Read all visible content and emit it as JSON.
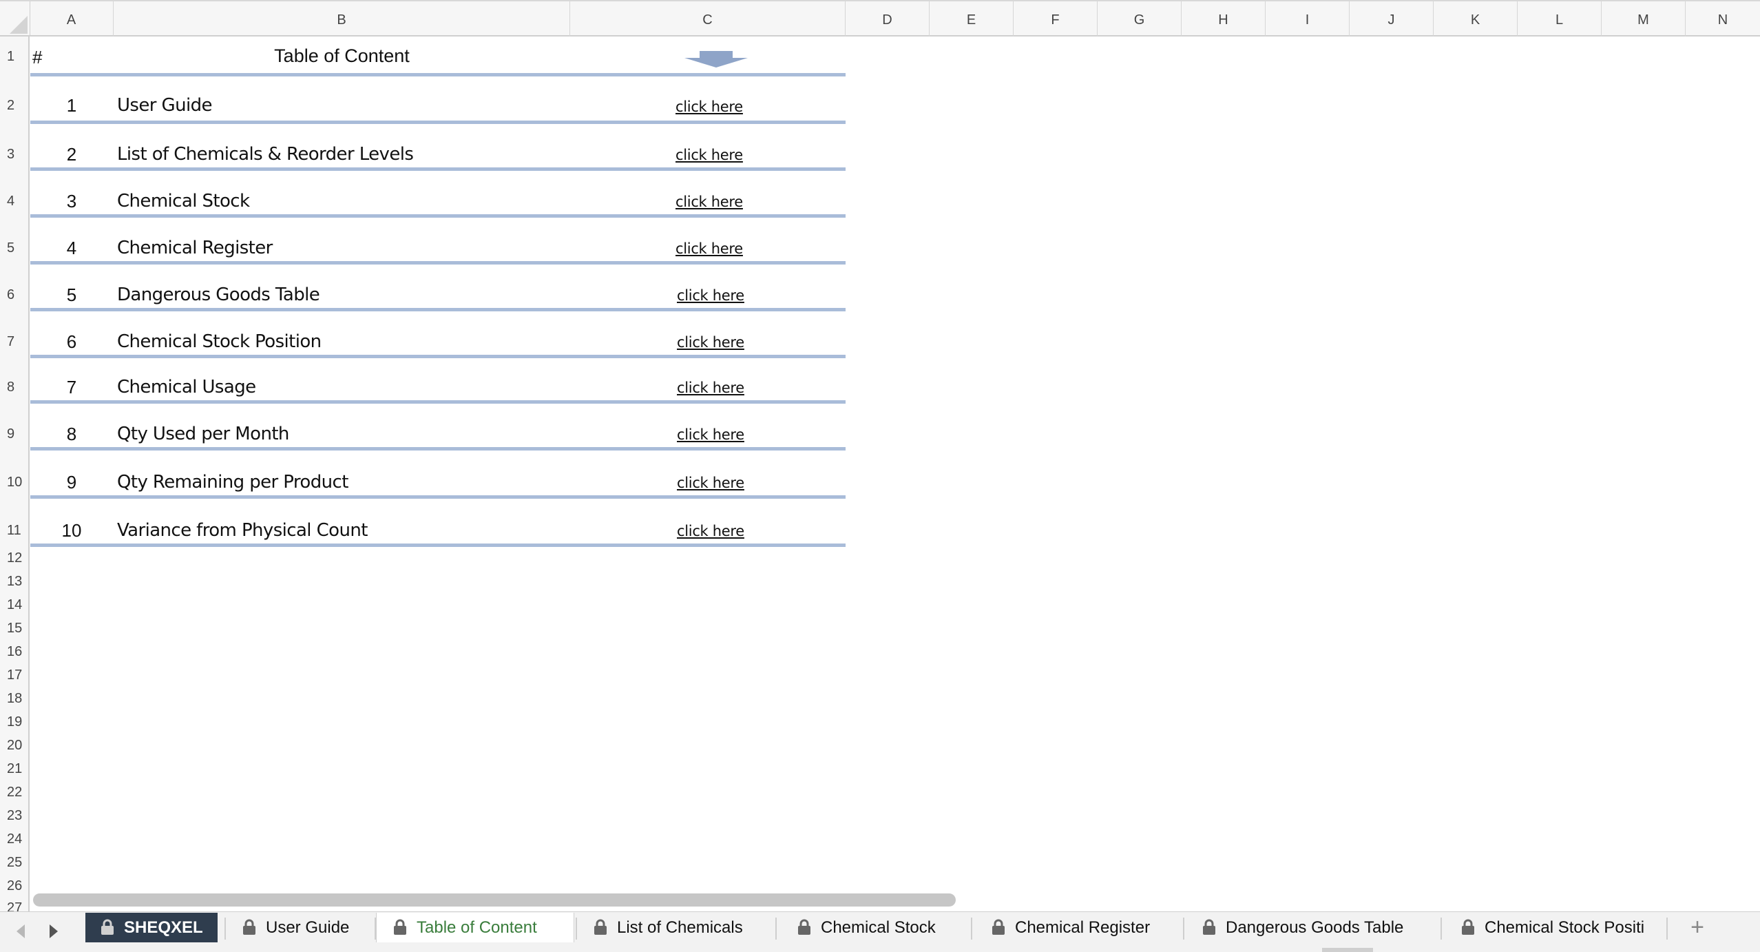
{
  "columns": [
    "A",
    "B",
    "C",
    "D",
    "E",
    "F",
    "G",
    "H",
    "I",
    "J",
    "K",
    "L",
    "M",
    "N"
  ],
  "rows": [
    "1",
    "2",
    "3",
    "4",
    "5",
    "6",
    "7",
    "8",
    "9",
    "10",
    "11",
    "12",
    "13",
    "14",
    "15",
    "16",
    "17",
    "18",
    "19",
    "20",
    "21",
    "22",
    "23",
    "24",
    "25",
    "26",
    "27"
  ],
  "toc": {
    "hash": "#",
    "title": "Table of Content",
    "items": [
      {
        "num": "1",
        "name": "User Guide",
        "link": "click here"
      },
      {
        "num": "2",
        "name": "List of Chemicals & Reorder Levels",
        "link": "click here"
      },
      {
        "num": "3",
        "name": "Chemical Stock",
        "link": "click here"
      },
      {
        "num": "4",
        "name": "Chemical Register",
        "link": "click here"
      },
      {
        "num": "5",
        "name": "Dangerous Goods Table",
        "link": "click here"
      },
      {
        "num": "6",
        "name": "Chemical Stock Position",
        "link": "click here"
      },
      {
        "num": "7",
        "name": "Chemical Usage",
        "link": "click here"
      },
      {
        "num": "8",
        "name": "Qty Used per Month",
        "link": "click here"
      },
      {
        "num": "9",
        "name": "Qty Remaining per Product",
        "link": "click here"
      },
      {
        "num": "10",
        "name": "Variance from Physical Count",
        "link": "click here"
      }
    ]
  },
  "tabs": [
    {
      "label": "SHEQXEL",
      "icon": "lock-icon"
    },
    {
      "label": "User Guide",
      "icon": "lock-icon"
    },
    {
      "label": "Table of Content",
      "icon": "lock-icon",
      "active": true
    },
    {
      "label": "List of Chemicals",
      "icon": "lock-icon"
    },
    {
      "label": "Chemical Stock",
      "icon": "lock-icon"
    },
    {
      "label": "Chemical Register",
      "icon": "lock-icon"
    },
    {
      "label": "Dangerous Goods Table",
      "icon": "lock-icon"
    },
    {
      "label": "Chemical Stock Positi",
      "icon": "lock-icon"
    }
  ],
  "add_sheet_label": "+",
  "colors": {
    "accent_line": "#a9bcd9",
    "active_tab_text": "#3a7d3c",
    "brand_tab_bg": "#2f3d4e"
  }
}
